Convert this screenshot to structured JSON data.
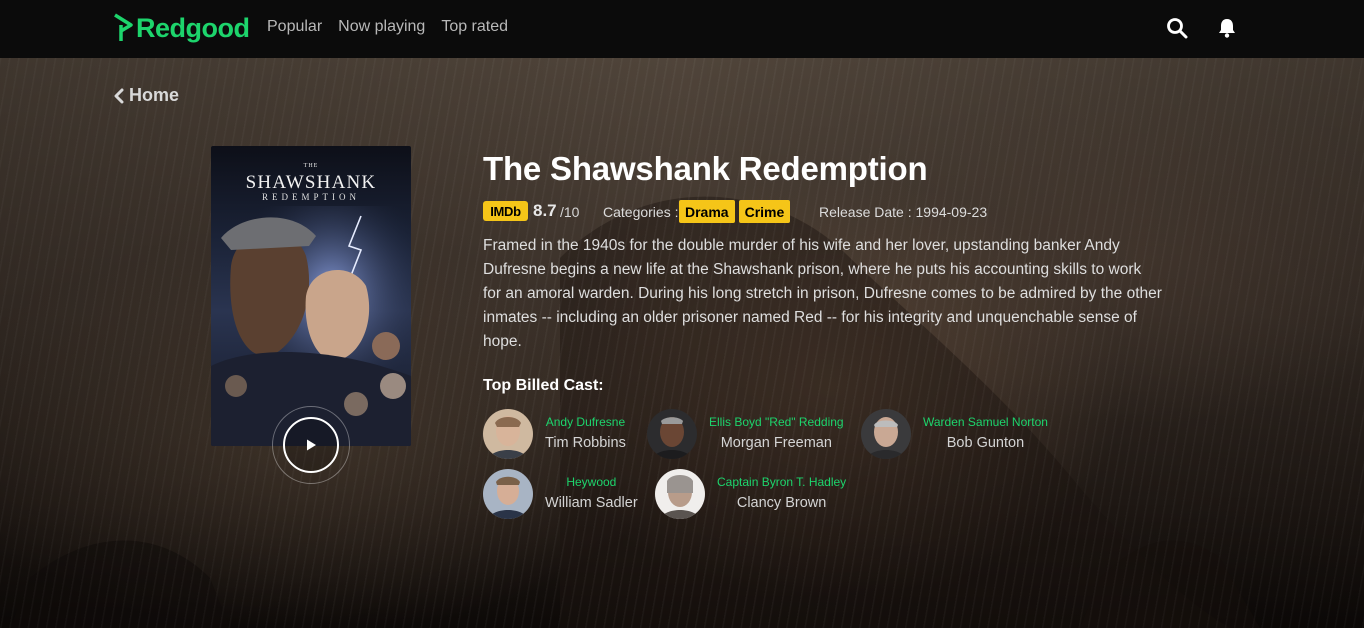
{
  "brand": {
    "name": "Redgood",
    "accent": "#1dd46c"
  },
  "nav": {
    "links": [
      "Popular",
      "Now playing",
      "Top rated"
    ],
    "icons": [
      "search-icon",
      "bell-icon"
    ]
  },
  "back": {
    "label": "Home"
  },
  "poster": {
    "small": "THE",
    "title": "SHAWSHANK",
    "subtitle": "REDEMPTION"
  },
  "movie": {
    "title": "The Shawshank Redemption",
    "imdb_label": "IMDb",
    "rating": "8.7",
    "rating_scale": "/10",
    "categories_label": "Categories :",
    "categories": [
      "Drama",
      "Crime"
    ],
    "release_date": "Release Date : 1994-09-23",
    "overview": "Framed in the 1940s for the double murder of his wife and her lover, upstanding banker Andy Dufresne begins a new life at the Shawshank prison, where he puts his accounting skills to work for an amoral warden. During his long stretch in prison, Dufresne comes to be admired by the other inmates -- including an older prisoner named Red -- for his integrity and unquenchable sense of hope."
  },
  "cast": {
    "heading": "Top Billed Cast:",
    "members": [
      {
        "character": "Andy Dufresne",
        "actor": "Tim Robbins"
      },
      {
        "character": "Ellis Boyd \"Red\" Redding",
        "actor": "Morgan Freeman"
      },
      {
        "character": "Warden Samuel Norton",
        "actor": "Bob Gunton"
      },
      {
        "character": "Heywood",
        "actor": "William Sadler"
      },
      {
        "character": "Captain Byron T. Hadley",
        "actor": "Clancy Brown"
      }
    ]
  },
  "colors": {
    "imdb": "#f5c518",
    "tag": "#f5c518",
    "navbar": "#0b0b0b"
  }
}
